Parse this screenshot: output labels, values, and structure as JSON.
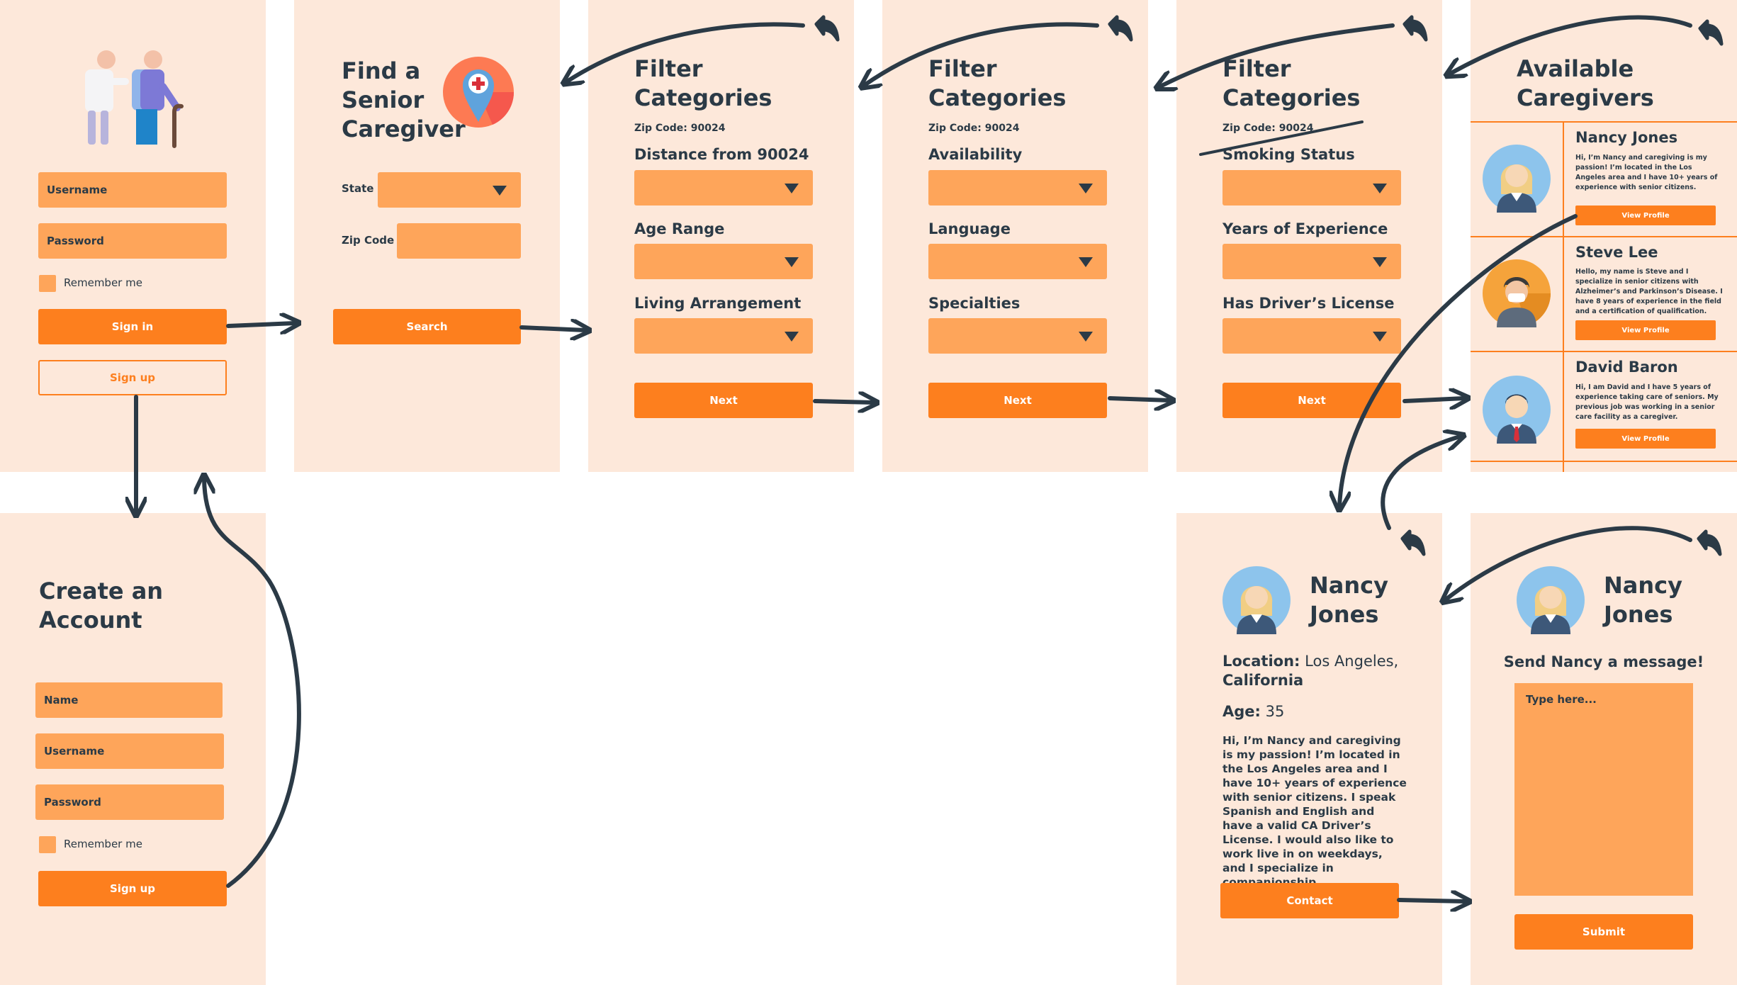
{
  "login": {
    "username_placeholder": "Username",
    "password_placeholder": "Password",
    "remember": "Remember me",
    "signin": "Sign in",
    "signup": "Sign up"
  },
  "find": {
    "title_line1": "Find a",
    "title_line2": "Senior",
    "title_line3": "Caregiver",
    "state_label": "State",
    "zip_label": "Zip Code",
    "search": "Search"
  },
  "filter1": {
    "title_line1": "Filter",
    "title_line2": "Categories",
    "zip": "Zip Code: 90024",
    "label1": "Distance from 90024",
    "label2": "Age Range",
    "label3": "Living Arrangement",
    "next": "Next"
  },
  "filter2": {
    "title_line1": "Filter",
    "title_line2": "Categories",
    "zip": "Zip Code: 90024",
    "label1": "Availability",
    "label2": "Language",
    "label3": "Specialties",
    "next": "Next"
  },
  "filter3": {
    "title_line1": "Filter",
    "title_line2": "Categories",
    "zip": "Zip Code: 90024",
    "label1": "Smoking Status",
    "label2": "Years of Experience",
    "label3": "Has Driver’s License",
    "next": "Next"
  },
  "caregivers": {
    "title_line1": "Available",
    "title_line2": "Caregivers",
    "view_profile": "View Profile",
    "items": [
      {
        "name": "Nancy Jones",
        "desc": "Hi, I’m Nancy and caregiving is my passion! I’m located in the Los Angeles area and I have 10+ years of experience with senior citizens."
      },
      {
        "name": "Steve Lee",
        "desc": "Hello, my name is Steve and I specialize in senior citizens with Alzheimer’s and Parkinson’s Disease. I have 8 years of experience in the field and a certification of qualification."
      },
      {
        "name": "David Baron",
        "desc": "Hi, I am David and I have 5 years of experience taking care of seniors. My previous job was working in a senior care facility as a caregiver."
      }
    ]
  },
  "create": {
    "title_line1": "Create an",
    "title_line2": "Account",
    "name_placeholder": "Name",
    "username_placeholder": "Username",
    "password_placeholder": "Password",
    "remember": "Remember me",
    "signup": "Sign up"
  },
  "profile": {
    "name_line1": "Nancy",
    "name_line2": "Jones",
    "location_label": "Location:",
    "location_value": "Los Angeles,",
    "location_value2": "California",
    "age_label": "Age:",
    "age_value": "35",
    "bio": "Hi, I’m Nancy and caregiving is my passion! I’m located in the Los Angeles area and I have 10+ years of experience with senior citizens. I speak Spanish and English and have a valid CA Driver’s License. I would also like to work live in on weekdays, and I specialize in companionship.",
    "contact": "Contact"
  },
  "message": {
    "name_line1": "Nancy",
    "name_line2": "Jones",
    "heading": "Send Nancy a message!",
    "placeholder": "Type here...",
    "submit": "Submit"
  },
  "colors": {
    "panel_bg": "#fde8da",
    "field": "#fea55a",
    "button": "#fd7f1e",
    "text": "#2b3a46",
    "arrow": "#2b3a46"
  }
}
